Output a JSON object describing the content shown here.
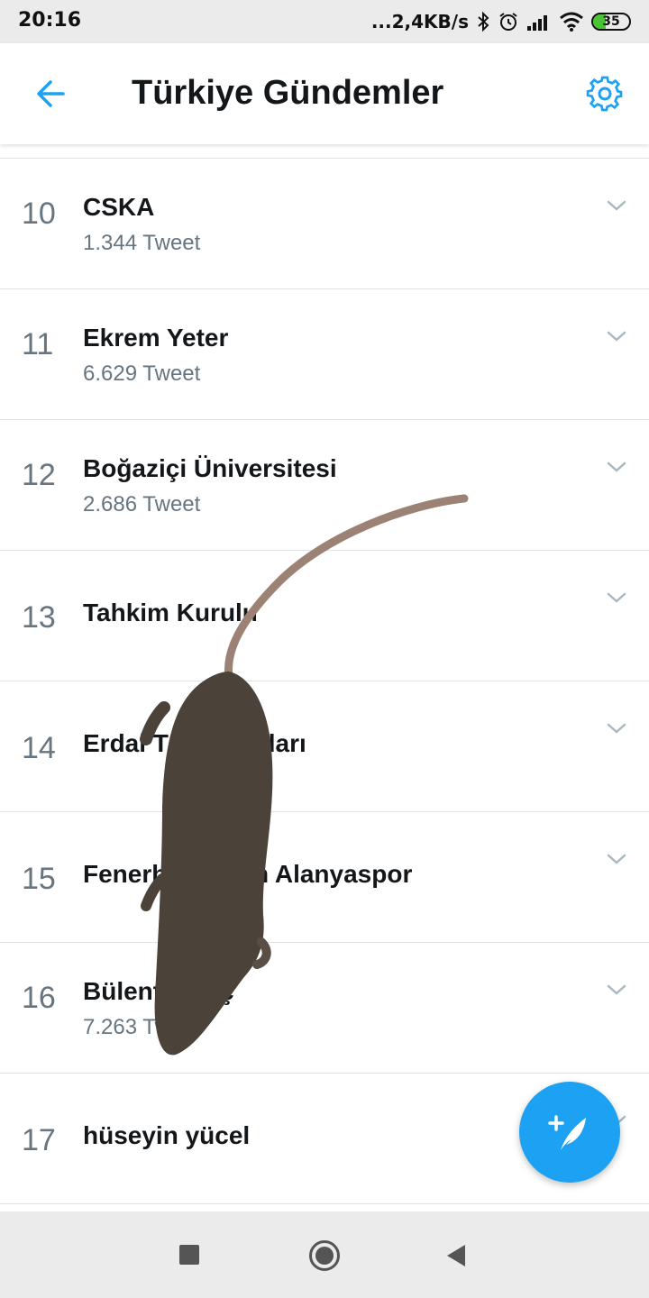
{
  "status_bar": {
    "time": "20:16",
    "network_speed": "...2,4KB/s",
    "battery_level": "35",
    "icons": [
      "bluetooth-icon",
      "alarm-icon",
      "signal-icon",
      "wifi-icon",
      "battery-icon"
    ]
  },
  "header": {
    "title": "Türkiye Gündemler",
    "back_icon": "arrow-left-icon",
    "settings_icon": "gear-icon"
  },
  "trends": [
    {
      "rank": "10",
      "name": "CSKA",
      "count": "1.344 Tweet"
    },
    {
      "rank": "11",
      "name": "Ekrem Yeter",
      "count": "6.629 Tweet"
    },
    {
      "rank": "12",
      "name": "Boğaziçi Üniversitesi",
      "count": "2.686 Tweet"
    },
    {
      "rank": "13",
      "name": "Tahkim Kurulu",
      "count": ""
    },
    {
      "rank": "14",
      "name": "Erdal T",
      "name_end": "lları",
      "count": ""
    },
    {
      "rank": "15",
      "name": "Fenerba",
      "name_end": "n Alanyaspor",
      "count": ""
    },
    {
      "rank": "16",
      "name": "Bülent",
      "name_end": "ç",
      "count": "7.263 Tweet"
    },
    {
      "rank": "17",
      "name": "hüseyin yücel",
      "count": ""
    }
  ],
  "fab": {
    "icon": "compose-tweet-icon"
  },
  "nav_bar": {
    "icons": [
      "recents-square-icon",
      "home-circle-icon",
      "back-triangle-icon"
    ]
  },
  "colors": {
    "accent": "#1da1f2",
    "text": "#14171a",
    "secondary": "#66757f",
    "divider": "#dfe3e6",
    "system_bar": "#ebebeb"
  }
}
